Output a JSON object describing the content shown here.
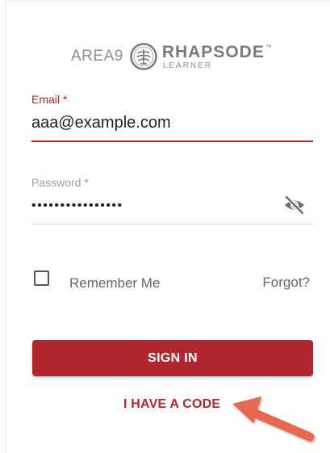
{
  "brand": {
    "area9": "AREA9",
    "rhapsode": "RHAPSODE",
    "tm": "™",
    "learner": "LEARNER"
  },
  "form": {
    "email": {
      "label": "Email *",
      "value": "aaa@example.com"
    },
    "password": {
      "label": "Password *",
      "value": "••••••••••••••••"
    },
    "remember_label": "Remember Me",
    "forgot_label": "Forgot?",
    "signin_label": "SIGN IN",
    "code_label": "I HAVE A CODE"
  },
  "icons": {
    "emblem": "tree-emblem-icon",
    "visibility": "visibility-off-icon",
    "annotation": "annotation-arrow-icon"
  },
  "colors": {
    "accent": "#b0282e",
    "annotation_arrow": "#e8674f",
    "text_primary": "#212121",
    "text_muted": "#666666"
  }
}
